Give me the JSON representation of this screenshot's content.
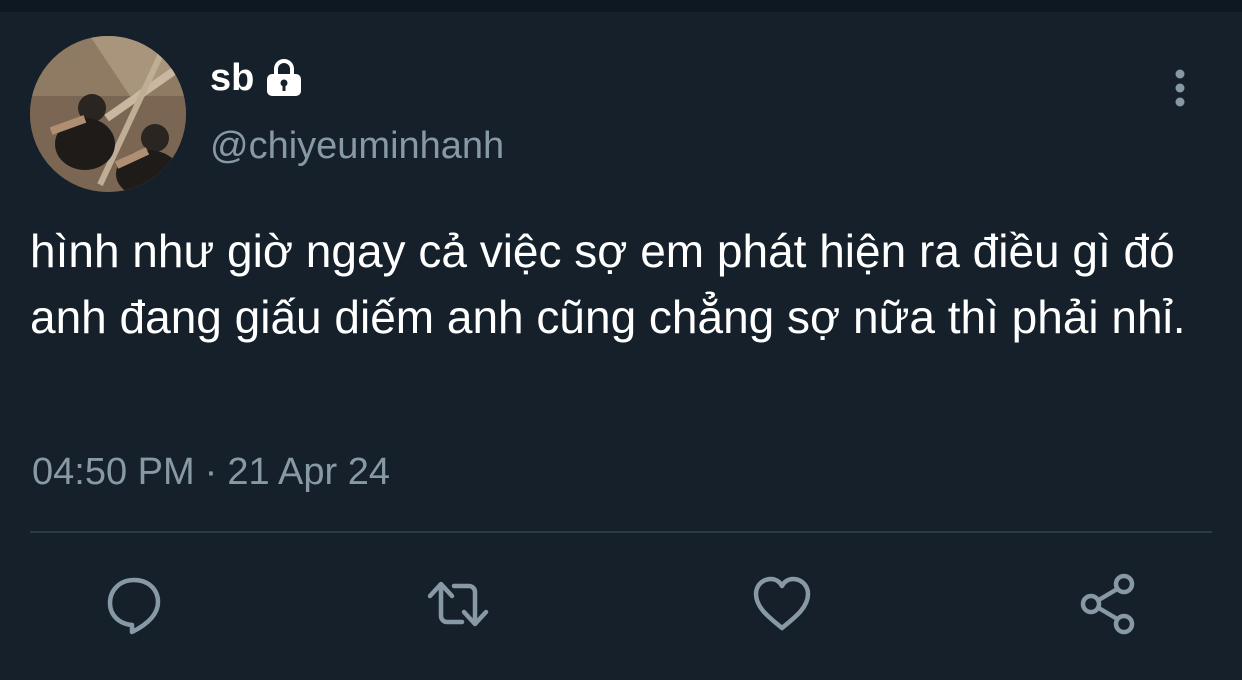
{
  "tweet": {
    "display_name": "sb",
    "handle": "@chiyeuminhanh",
    "text": "hình như giờ ngay cả việc sợ em phát hiện ra điều gì đó anh đang giấu diếm anh cũng chẳng sợ nữa thì phải nhỉ.",
    "time": "04:50 PM",
    "separator": "·",
    "date": "21 Apr 24",
    "protected": true
  },
  "icons": {
    "account": "lock-icon",
    "menu": "more-vertical-icon",
    "reply": "reply-icon",
    "retweet": "retweet-icon",
    "like": "heart-icon",
    "share": "share-icon"
  },
  "colors": {
    "background": "#15202b",
    "text_primary": "#ffffff",
    "text_secondary": "#8899a6",
    "divider": "#2c3946"
  }
}
